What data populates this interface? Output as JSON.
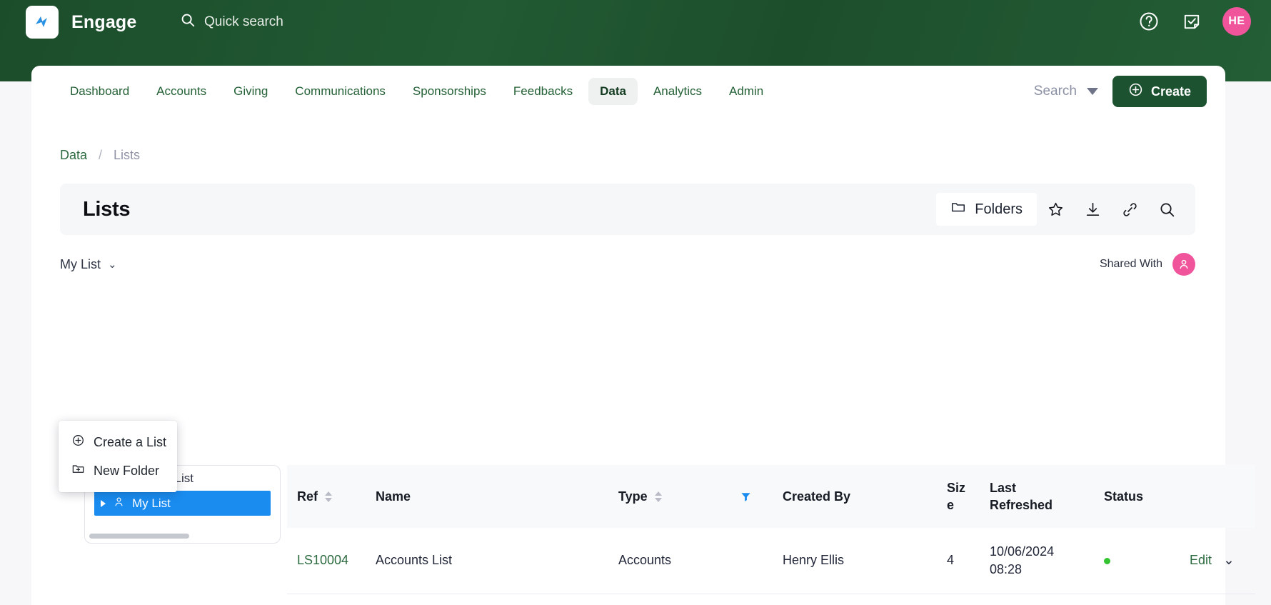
{
  "topbar": {
    "brand": "Engage",
    "logo_icon": "engage-logo-icon",
    "quick_search_label": "Quick search",
    "quick_search_icon": "search-icon",
    "help_icon": "help-circle-icon",
    "tasks_icon": "task-note-icon",
    "avatar_initials": "HE",
    "colors": {
      "bar": "#1c4f2c",
      "avatar": "#f0559c"
    }
  },
  "nav": {
    "items": [
      {
        "label": "Dashboard",
        "active": false
      },
      {
        "label": "Accounts",
        "active": false
      },
      {
        "label": "Giving",
        "active": false
      },
      {
        "label": "Communications",
        "active": false
      },
      {
        "label": "Sponsorships",
        "active": false
      },
      {
        "label": "Feedbacks",
        "active": false
      },
      {
        "label": "Data",
        "active": true
      },
      {
        "label": "Analytics",
        "active": false
      },
      {
        "label": "Admin",
        "active": false
      }
    ],
    "search_label": "Search",
    "create_label": "Create",
    "create_icon": "plus-circle-icon",
    "create_color": "#1c5230"
  },
  "breadcrumb": {
    "parent": "Data",
    "separator": "/",
    "current": "Lists"
  },
  "page": {
    "title": "Lists",
    "tools": {
      "folders_label": "Folders",
      "folder_icon": "folder-icon",
      "star_icon": "star-icon",
      "download_icon": "download-icon",
      "link_icon": "link-icon",
      "search_icon": "search-icon"
    }
  },
  "list_selector": {
    "label": "My List",
    "chevron_icon": "chevron-down-icon",
    "menu": [
      {
        "label": "Create a List",
        "icon": "plus-circle-icon"
      },
      {
        "label": "New Folder",
        "icon": "new-folder-icon"
      }
    ]
  },
  "shared_with": {
    "label": "Shared With",
    "avatar_icon": "person-icon",
    "avatar_color": "#f0559c"
  },
  "tree": {
    "items": [
      {
        "label": "Shared List",
        "icon": "share-icon",
        "selected": false
      },
      {
        "label": "My List",
        "icon": "person-icon",
        "selected": true
      }
    ]
  },
  "table": {
    "columns": [
      {
        "label": "Ref",
        "sortable": true
      },
      {
        "label": "Name",
        "sortable": false
      },
      {
        "label": "Type",
        "sortable": true
      },
      {
        "label": "",
        "filter_icon": "filter-icon"
      },
      {
        "label": "Created By",
        "sortable": false
      },
      {
        "label": "Siz\ne",
        "sortable": false
      },
      {
        "label": "Last\nRefreshed",
        "sortable": false
      },
      {
        "label": "Status",
        "sortable": false
      },
      {
        "label": "",
        "sortable": false
      }
    ],
    "rows": [
      {
        "ref": "LS10004",
        "name": "Accounts List",
        "type": "Accounts",
        "created_by": "Henry Ellis",
        "size": "4",
        "last_refreshed_date": "10/06/2024",
        "last_refreshed_time": "08:28",
        "status": "active",
        "status_color": "#34c431",
        "action_label": "Edit",
        "action_icon": "chevron-down-icon"
      }
    ]
  }
}
